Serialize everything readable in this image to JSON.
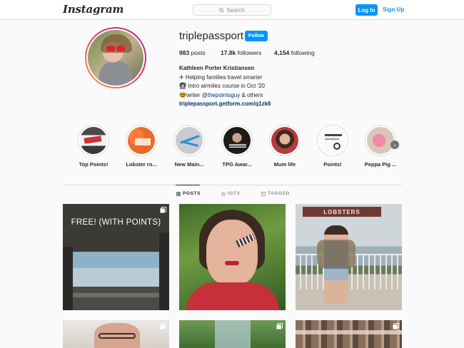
{
  "header": {
    "logo": "Instagram",
    "search_placeholder": "Search",
    "login_label": "Log In",
    "signup_label": "Sign Up"
  },
  "profile": {
    "username": "triplepassport",
    "follow_label": "Follow",
    "posts_count": "983",
    "posts_label": "posts",
    "followers_count": "17.8k",
    "followers_label": "followers",
    "following_count": "4,154",
    "following_label": "following",
    "full_name": "Kathleen Porter Kristiansen",
    "bio_line1": "✈ Helping families travel smarter",
    "bio_line2": "👩🏻‍🏫 Intro airmiles course in Oct '20",
    "bio_line3_prefix": "🤓writer ",
    "bio_line3_mention": "@thepointsguy",
    "bio_line3_suffix": " & others",
    "link": "triplepassport.getform.com/q1zk6"
  },
  "highlights": [
    {
      "label": "Top Points!"
    },
    {
      "label": "Lobster ro..."
    },
    {
      "label": "New Main..."
    },
    {
      "label": "TPG Awar..."
    },
    {
      "label": "Mum life"
    },
    {
      "label": "Points!"
    },
    {
      "label": "Peppa Pig ..."
    }
  ],
  "tabs": {
    "posts": "POSTS",
    "igtv": "IGTV",
    "tagged": "TAGGED"
  },
  "posts": {
    "post1_caption": "FREE! (WITH POINTS)",
    "post3_sign": "LOBSTERS"
  },
  "colors": {
    "accent": "#0095f6",
    "text": "#262626",
    "muted": "#8e8e8e",
    "link": "#00376b"
  }
}
